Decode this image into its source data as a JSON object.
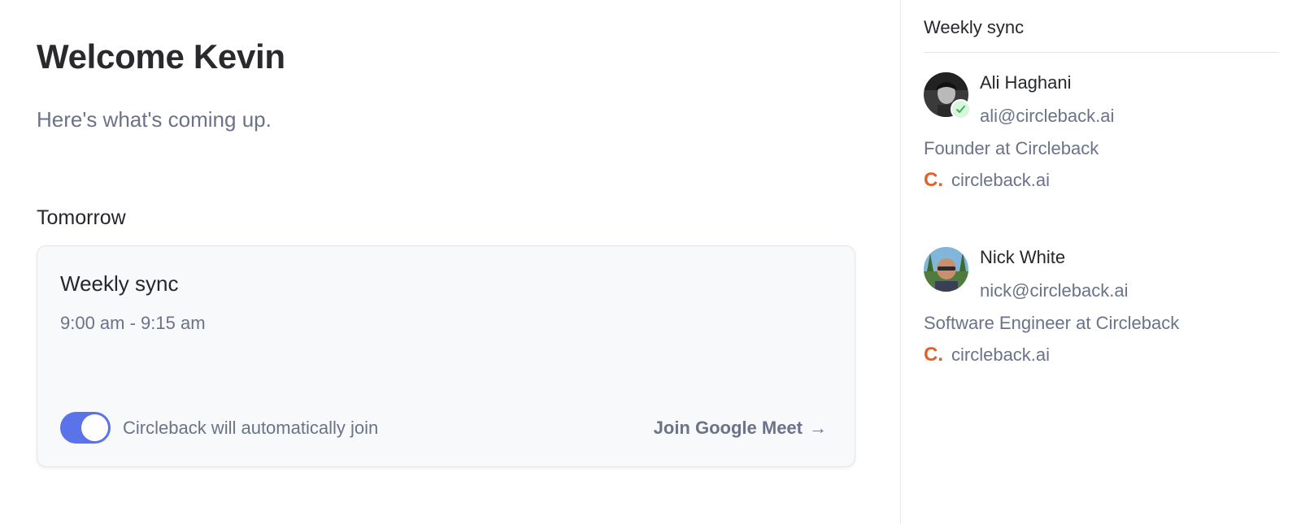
{
  "main": {
    "welcome": "Welcome Kevin",
    "subtitle": "Here's what's coming up.",
    "day_label": "Tomorrow",
    "meeting": {
      "title": "Weekly sync",
      "time": "9:00 am - 9:15 am",
      "auto_join_enabled": true,
      "auto_join_label": "Circleback will automatically join",
      "join_label": "Join Google Meet",
      "join_arrow": "→"
    }
  },
  "sidebar": {
    "title": "Weekly sync",
    "attendees": [
      {
        "name": "Ali Haghani",
        "email": "ali@circleback.ai",
        "role": "Founder at Circleback",
        "company_logo": "C.",
        "company_domain": "circleback.ai",
        "accepted": true
      },
      {
        "name": "Nick White",
        "email": "nick@circleback.ai",
        "role": "Software Engineer at Circleback",
        "company_logo": "C.",
        "company_domain": "circleback.ai",
        "accepted": false
      }
    ]
  },
  "colors": {
    "accent": "#5b73e8",
    "brand": "#e2602a",
    "muted_text": "#6b7289",
    "accepted_badge": "#d9f5dd",
    "accepted_check": "#3bb54a"
  },
  "icons": {
    "toggle": "toggle-switch-on",
    "join_arrow": "arrow-right-icon",
    "accepted": "check-icon",
    "company": "circleback-logo-icon"
  }
}
